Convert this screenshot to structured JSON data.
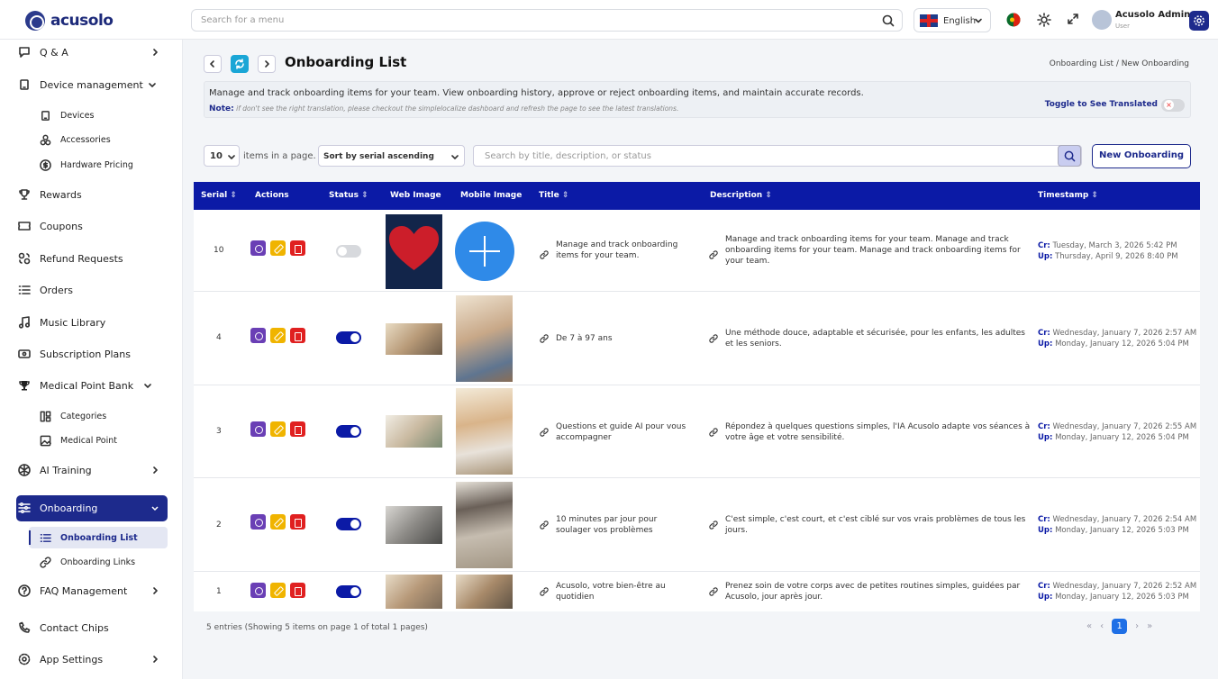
{
  "header": {
    "logo_text": "acusolo",
    "search_placeholder": "Search for a menu",
    "language": "English",
    "user_name": "Acusolo Admin",
    "user_role": "User"
  },
  "sidebar": {
    "items": [
      {
        "label": "Q & A"
      },
      {
        "label": "Device management"
      },
      {
        "label": "Devices"
      },
      {
        "label": "Accessories"
      },
      {
        "label": "Hardware Pricing"
      },
      {
        "label": "Rewards"
      },
      {
        "label": "Coupons"
      },
      {
        "label": "Refund Requests"
      },
      {
        "label": "Orders"
      },
      {
        "label": "Music Library"
      },
      {
        "label": "Subscription Plans"
      },
      {
        "label": "Medical Point Bank"
      },
      {
        "label": "Categories"
      },
      {
        "label": "Medical Point"
      },
      {
        "label": "AI Training"
      },
      {
        "label": "Onboarding"
      },
      {
        "label": "Onboarding List"
      },
      {
        "label": "Onboarding Links"
      },
      {
        "label": "FAQ Management"
      },
      {
        "label": "Contact Chips"
      },
      {
        "label": "App Settings"
      }
    ]
  },
  "page": {
    "title": "Onboarding List",
    "breadcrumb": "Onboarding List / New Onboarding",
    "description": "Manage and track onboarding items for your team. View onboarding history, approve or reject onboarding items, and maintain accurate records.",
    "note_label": "Note:",
    "note_text": "if don't see the right translation, please checkout the simplelocalize dashboard and refresh the page to see the latest translations.",
    "toggle_label": "Toggle to See Translated"
  },
  "controls": {
    "per_page": "10",
    "per_page_label": "items in a page.",
    "sort": "Sort by serial ascending",
    "search_placeholder": "Search by title, description, or status",
    "new_button": "New Onboarding"
  },
  "table": {
    "headers": [
      "Serial",
      "Actions",
      "Status",
      "Web Image",
      "Mobile Image",
      "Title",
      "Description",
      "Timestamp"
    ],
    "rows": [
      {
        "serial": "10",
        "status": false,
        "title": "Manage and track onboarding items for your team.",
        "description": "Manage and track onboarding items for your team. Manage and track onboarding items for your team. Manage and track onboarding items for your team.",
        "created": "Tuesday, March 3, 2026 5:42 PM",
        "updated": "Thursday, April 9, 2026 8:40 PM"
      },
      {
        "serial": "4",
        "status": true,
        "title": "De 7 à 97 ans",
        "description": "Une méthode douce, adaptable et sécurisée, pour les enfants, les adultes et les seniors.",
        "created": "Wednesday, January 7, 2026 2:57 AM",
        "updated": "Monday, January 12, 2026 5:04 PM"
      },
      {
        "serial": "3",
        "status": true,
        "title": "Questions et guide AI pour vous accompagner",
        "description": "Répondez à quelques questions simples, l'IA Acusolo adapte vos séances à votre âge et votre sensibilité.",
        "created": "Wednesday, January 7, 2026 2:55 AM",
        "updated": "Monday, January 12, 2026 5:04 PM"
      },
      {
        "serial": "2",
        "status": true,
        "title": "10 minutes par jour pour soulager vos problèmes",
        "description": "C'est simple, c'est court, et c'est ciblé sur vos vrais problèmes de tous les jours.",
        "created": "Wednesday, January 7, 2026 2:54 AM",
        "updated": "Monday, January 12, 2026 5:03 PM"
      },
      {
        "serial": "1",
        "status": true,
        "title": "Acusolo, votre bien-être au quotidien",
        "description": "Prenez soin de votre corps avec de petites routines simples, guidées par Acusolo, jour après jour.",
        "created": "Wednesday, January 7, 2026 2:52 AM",
        "updated": "Monday, January 12, 2026 5:03 PM"
      }
    ],
    "created_label": "Cr:",
    "updated_label": "Up:"
  },
  "footer": {
    "entries": "5 entries (Showing 5 items on page 1 of total 1 pages)",
    "current_page": "1",
    "first": "«",
    "prev": "‹",
    "next": "›",
    "last": "»"
  },
  "colors": {
    "primary": "#1d2a8c",
    "header_bg": "#0b1aa6",
    "accent": "#1e6fe6"
  }
}
